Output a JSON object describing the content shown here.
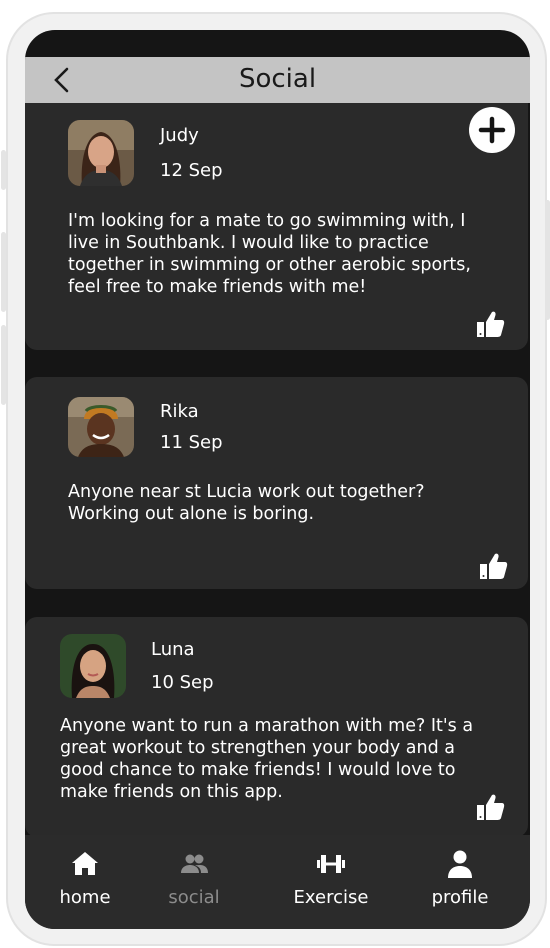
{
  "header": {
    "title": "Social"
  },
  "posts": [
    {
      "name": "Judy",
      "date": "12 Sep",
      "text": "I'm looking for a mate to go swimming with, I live in Southbank. I would like to practice together in swimming or other aerobic sports, feel free to make friends with me!"
    },
    {
      "name": "Rika",
      "date": "11 Sep",
      "text": "Anyone near st Lucia work out together? Working out alone is boring."
    },
    {
      "name": "Luna",
      "date": "10 Sep",
      "text": "Anyone want to run a marathon with me? It's a great workout to strengthen your body and a good chance to make friends! I would love to make friends on this app."
    }
  ],
  "nav": {
    "items": [
      {
        "label": "home",
        "icon": "home-icon"
      },
      {
        "label": "social",
        "icon": "people-icon",
        "active": true
      },
      {
        "label": "Exercise",
        "icon": "dumbbell-icon"
      },
      {
        "label": "profile",
        "icon": "person-icon"
      }
    ]
  },
  "colors": {
    "screen_bg": "#151515",
    "card_bg": "#2a2a2a",
    "header_bg": "#c4c4c4",
    "nav_bg": "#2b2b2b",
    "inactive_nav": "#8c8c8c"
  }
}
